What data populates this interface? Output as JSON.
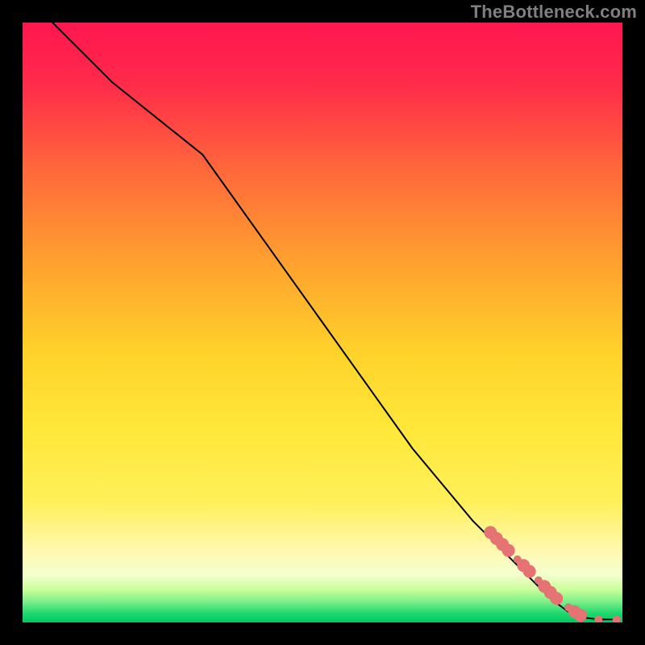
{
  "watermark": "TheBottleneck.com",
  "chart_data": {
    "type": "line",
    "title": "",
    "xlabel": "",
    "ylabel": "",
    "xlim": [
      0,
      100
    ],
    "ylim": [
      0,
      100
    ],
    "background_gradient": {
      "top": "#ff1a4e",
      "mid_upper": "#ffa82a",
      "mid": "#ffe135",
      "mid_lower": "#fff39a",
      "band": "#c7ff8a",
      "bottom": "#00e676"
    },
    "series": [
      {
        "name": "curve",
        "type": "line",
        "color": "#000000",
        "width": 2,
        "x": [
          5,
          10,
          15,
          20,
          25,
          30,
          35,
          40,
          45,
          50,
          55,
          60,
          65,
          70,
          75,
          80,
          85,
          88,
          92,
          96,
          99
        ],
        "y": [
          100,
          95,
          90,
          86,
          82,
          78,
          71,
          64,
          57,
          50,
          43,
          36,
          29,
          23,
          17,
          12,
          7,
          4,
          1,
          0.5,
          0.5
        ]
      },
      {
        "name": "highlight-points",
        "type": "scatter",
        "color": "#e57373",
        "radius_small": 5,
        "radius_large": 8,
        "points": [
          {
            "x": 78,
            "y": 15,
            "r": "large"
          },
          {
            "x": 79,
            "y": 14,
            "r": "large"
          },
          {
            "x": 80,
            "y": 13,
            "r": "large"
          },
          {
            "x": 81,
            "y": 12,
            "r": "large"
          },
          {
            "x": 82.5,
            "y": 10.5,
            "r": "small"
          },
          {
            "x": 83.5,
            "y": 9.5,
            "r": "large"
          },
          {
            "x": 84.5,
            "y": 8.5,
            "r": "large"
          },
          {
            "x": 86,
            "y": 7,
            "r": "small"
          },
          {
            "x": 87,
            "y": 6,
            "r": "large"
          },
          {
            "x": 88,
            "y": 5,
            "r": "large"
          },
          {
            "x": 89,
            "y": 4,
            "r": "large"
          },
          {
            "x": 91,
            "y": 2.5,
            "r": "small"
          },
          {
            "x": 92,
            "y": 1.8,
            "r": "large"
          },
          {
            "x": 93,
            "y": 1.2,
            "r": "large"
          },
          {
            "x": 96,
            "y": 0.5,
            "r": "small"
          },
          {
            "x": 99,
            "y": 0.5,
            "r": "small"
          }
        ]
      }
    ]
  }
}
